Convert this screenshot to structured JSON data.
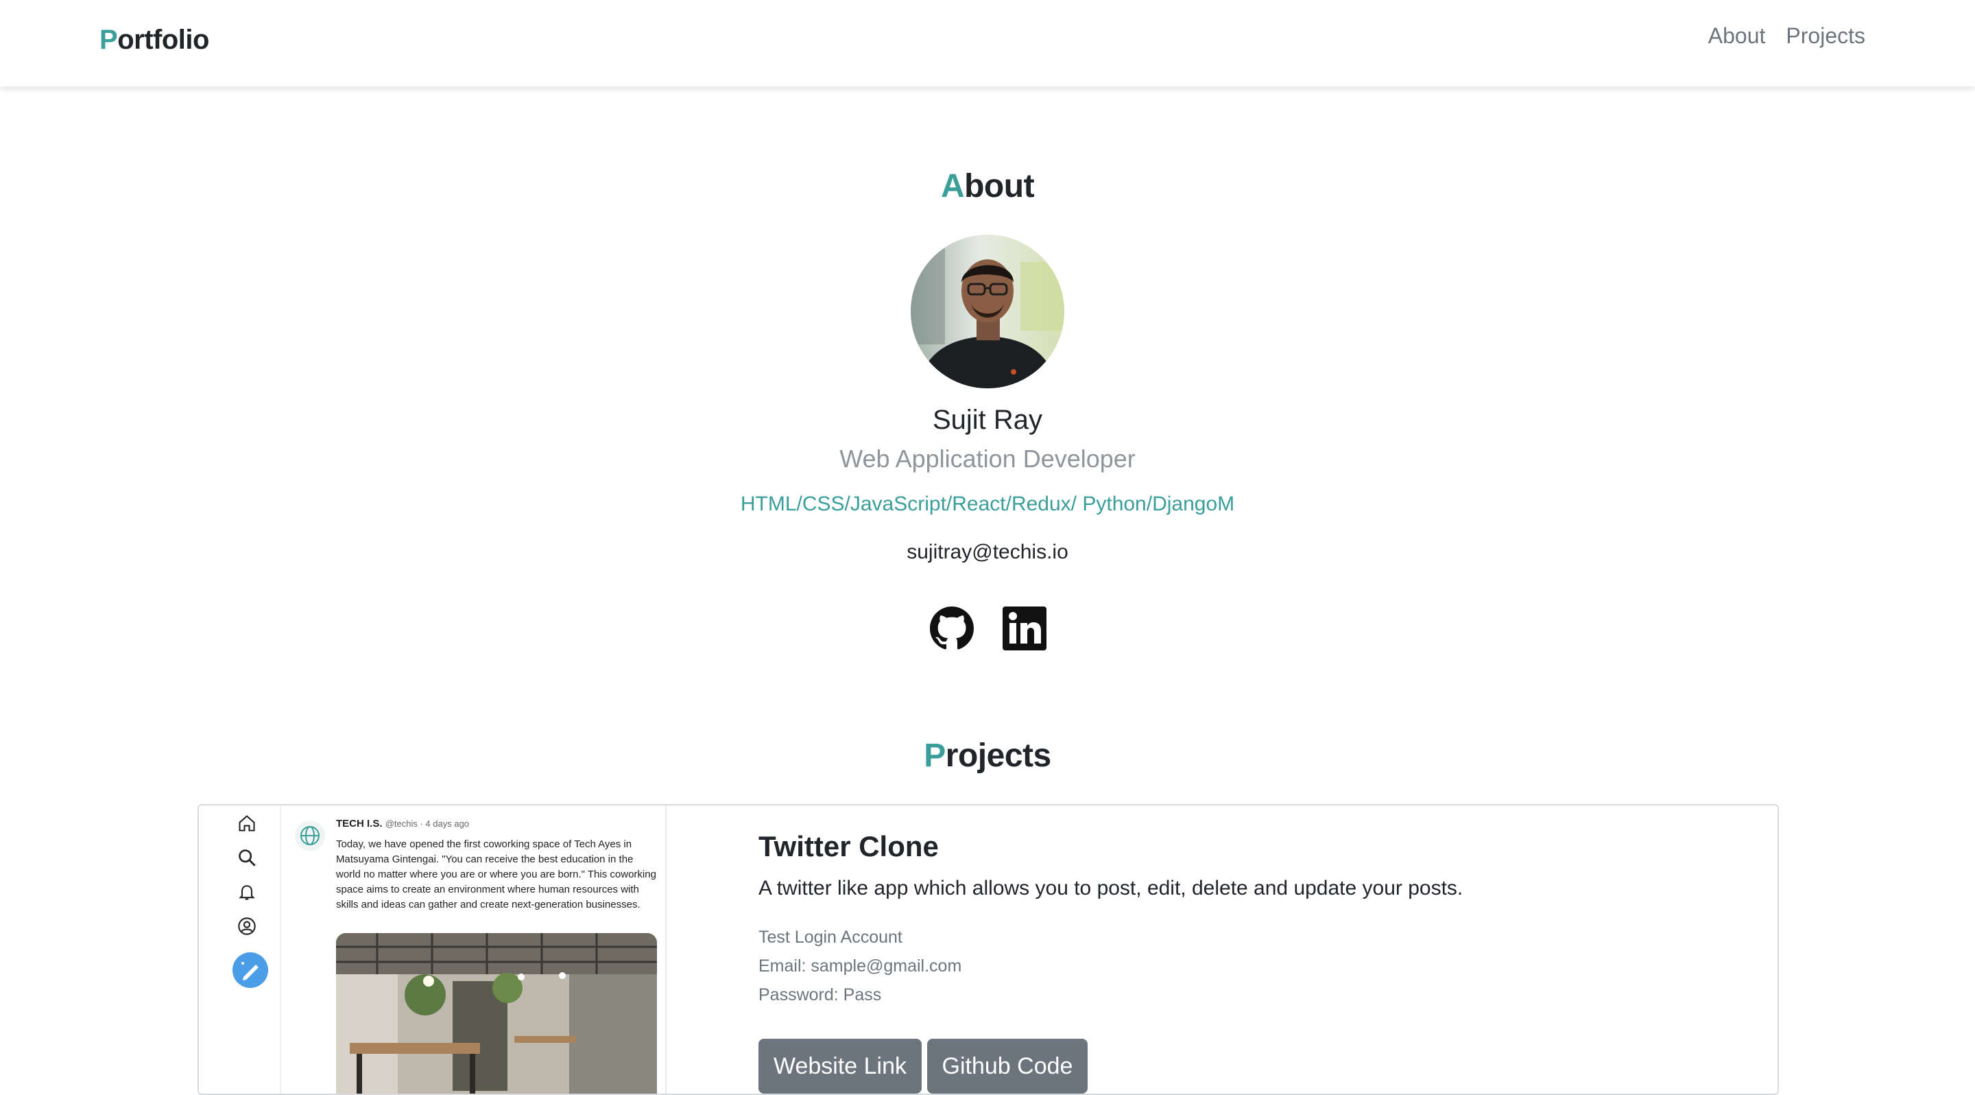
{
  "navbar": {
    "brand_initial": "P",
    "brand_rest": "ortfolio",
    "links": [
      "About",
      "Projects"
    ]
  },
  "about": {
    "title_initial": "A",
    "title_rest": "bout",
    "name": "Sujit Ray",
    "role": "Web Application Developer",
    "skills": "HTML/CSS/JavaScript/React/Redux/ Python/DjangoM",
    "email": "sujitray@techis.io",
    "socials": [
      "github-icon",
      "linkedin-icon"
    ]
  },
  "projects": {
    "title_initial": "P",
    "title_rest": "rojects",
    "items": [
      {
        "title": "Twitter Clone",
        "description": "A twitter like app which allows you to post, edit, delete and update your posts.",
        "meta": [
          "Test Login Account",
          "Email: sample@gmail.com",
          "Password: Pass"
        ],
        "buttons": [
          "Website Link",
          "Github Code"
        ],
        "preview": {
          "author": "TECH I.S.",
          "handle": "@techis · 4 days ago",
          "text": "Today, we have opened the first coworking space of Tech Ayes in Matsuyama Gintengai. \"You can receive the best education in the world no matter where you are or where you are born.\" This coworking space aims to create an environment where human resources with skills and ideas can gather and create next-generation businesses."
        }
      }
    ]
  },
  "colors": {
    "accent": "#3a9e9a",
    "button": "#6c757d",
    "muted": "#8e959b"
  }
}
